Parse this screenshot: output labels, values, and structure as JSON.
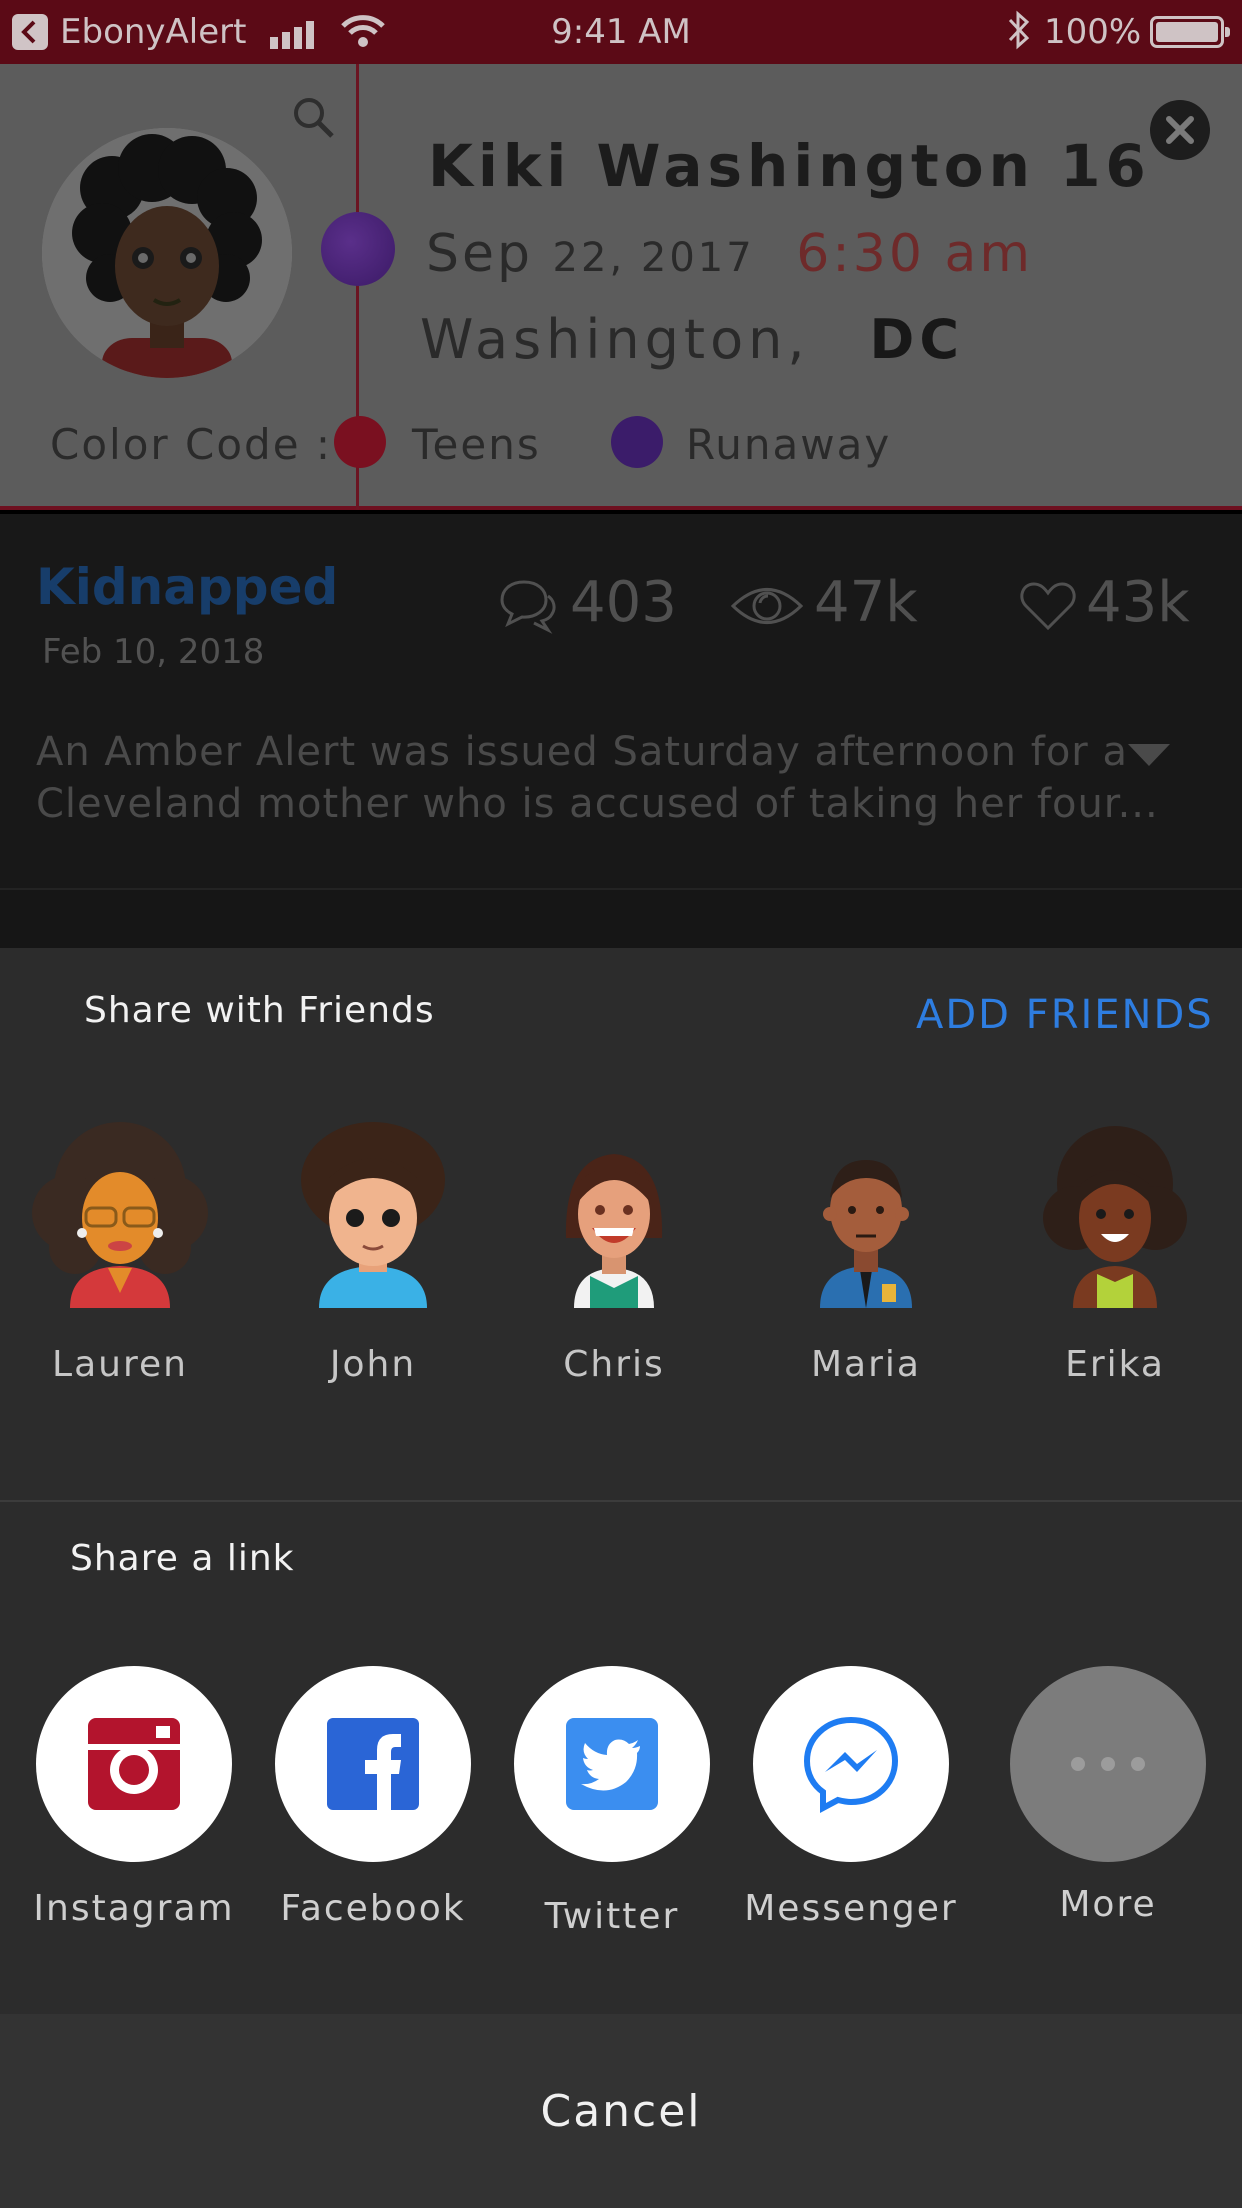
{
  "status_bar": {
    "app_name": "EbonyAlert",
    "time": "9:41 AM",
    "battery": "100%"
  },
  "alert": {
    "name": "Kiki Washington 16",
    "date_month": "Sep",
    "date_rest": "22, 2017",
    "time": "6:30 am",
    "city": "Washington,",
    "state": "DC",
    "legend_label": "Color Code :",
    "legend_items": [
      "Teens",
      "Runaway"
    ],
    "colors": {
      "teens": "#c8102e",
      "runaway": "#5b2ca0"
    }
  },
  "story": {
    "title": "Kidnapped",
    "date": "Feb 10, 2018",
    "comments": "403",
    "views": "47k",
    "likes": "43k",
    "text": "An Amber Alert was issued Saturday afternoon for a Cleveland mother who is accused of taking her four..."
  },
  "share": {
    "friends_heading": "Share with Friends",
    "add_friends": "ADD FRIENDS",
    "friends": [
      "Lauren",
      "John",
      "Chris",
      "Maria",
      "Erika"
    ],
    "link_heading": "Share a link",
    "apps": [
      "Instagram",
      "Facebook",
      "Twitter",
      "Messenger",
      "More"
    ],
    "cancel": "Cancel"
  },
  "colors": {
    "accent_blue": "#2e7de0",
    "instagram": "#b3142d",
    "facebook": "#2a65d6",
    "twitter": "#3b8ef0",
    "messenger": "#1e7cf2"
  }
}
